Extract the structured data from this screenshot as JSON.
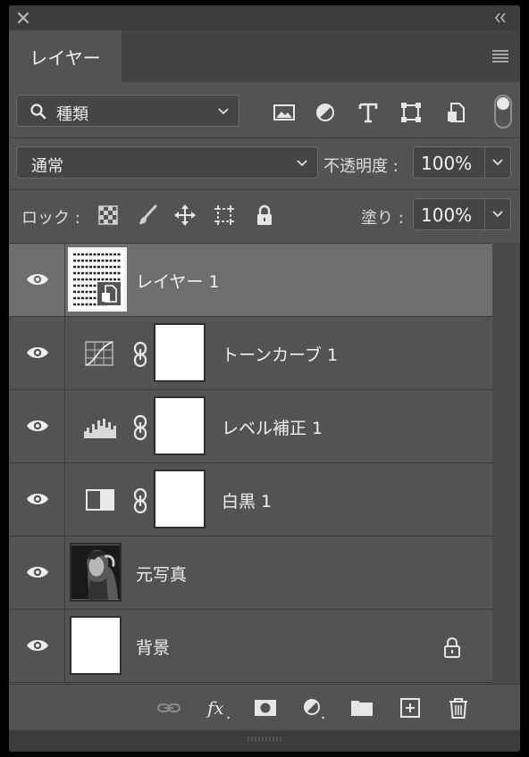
{
  "tabs": {
    "layers_label": "レイヤー"
  },
  "filter": {
    "kind_label": "種類"
  },
  "blend": {
    "mode_label": "通常",
    "opacity_label": "不透明度 :",
    "opacity_value": "100%",
    "fill_label": "塗り :",
    "fill_value": "100%"
  },
  "lock": {
    "label": "ロック :"
  },
  "layers": [
    {
      "name": "レイヤー 1",
      "type": "smart-object",
      "visible": true,
      "selected": true
    },
    {
      "name": "トーンカーブ 1",
      "type": "curves-adjustment",
      "visible": true,
      "selected": false
    },
    {
      "name": "レベル補正 1",
      "type": "levels-adjustment",
      "visible": true,
      "selected": false
    },
    {
      "name": "白黒 1",
      "type": "black-white-adjustment",
      "visible": true,
      "selected": false
    },
    {
      "name": "元写真",
      "type": "photo",
      "visible": true,
      "selected": false
    },
    {
      "name": "背景",
      "type": "background",
      "visible": true,
      "selected": false,
      "locked": true
    }
  ],
  "icons": {
    "filter": [
      "image-filter-icon",
      "adjustment-filter-icon",
      "type-filter-icon",
      "shape-filter-icon",
      "smart-object-filter-icon"
    ],
    "lock": [
      "lock-transparent-pixels-icon",
      "lock-image-pixels-icon",
      "lock-position-icon",
      "lock-artboard-icon",
      "lock-all-icon"
    ],
    "bottom": [
      "link-layers-icon",
      "fx-icon",
      "add-mask-icon",
      "new-adjustment-layer-icon",
      "new-group-icon",
      "new-layer-icon",
      "delete-layer-icon"
    ]
  }
}
